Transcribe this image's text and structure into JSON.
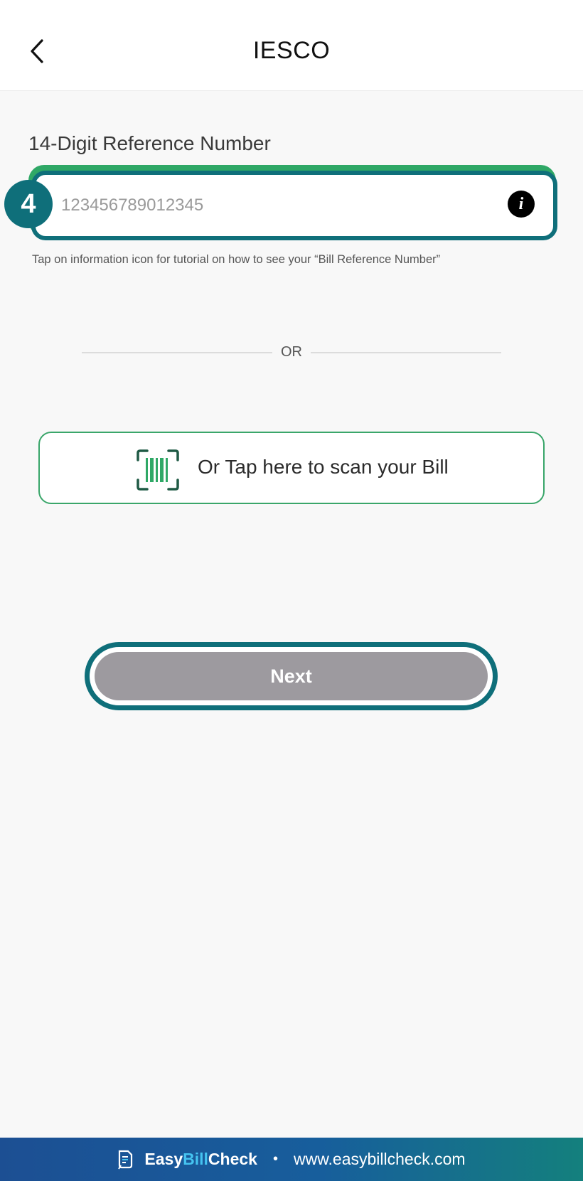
{
  "header": {
    "title": "IESCO",
    "back_icon": "chevron-left-icon"
  },
  "reference": {
    "label": "14-Digit Reference Number",
    "placeholder": "123456789012345",
    "value": "",
    "info_icon": "info-icon",
    "step_number": "4",
    "hint": "Tap on information icon for tutorial on how to see your “Bill Reference Number”"
  },
  "divider": {
    "text": "OR"
  },
  "scan": {
    "label": "Or Tap here to scan your Bill",
    "icon": "barcode-scan-icon"
  },
  "next": {
    "label": "Next"
  },
  "colors": {
    "accent_teal": "#0f6f7a",
    "green": "#2fa866",
    "disabled_button": "#9d9a9f",
    "footer_blue": "#1c4f93",
    "footer_teal": "#14807d"
  },
  "footer": {
    "brand_easy": "Easy",
    "brand_bill": "Bill",
    "brand_check": "Check",
    "separator": "•",
    "url": "www.easybillcheck.com",
    "brand_icon": "document-check-icon"
  }
}
